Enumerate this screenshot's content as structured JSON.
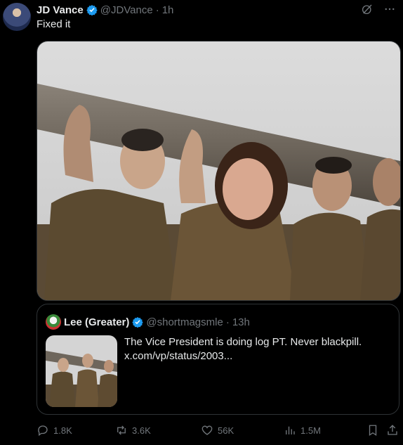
{
  "tweet": {
    "author_name": "JD Vance",
    "author_handle": "@JDVance",
    "separator": "·",
    "time": "1h",
    "text": "Fixed it"
  },
  "quote": {
    "author_name": "Lee (Greater)",
    "author_handle": "@shortmagsmle",
    "separator": "·",
    "time": "13h",
    "text": "The Vice President is doing log PT. Never blackpill. x.com/vp/status/2003..."
  },
  "actions": {
    "replies": "1.8K",
    "reposts": "3.6K",
    "likes": "56K",
    "views": "1.5M"
  },
  "icons": [
    "verified-badge-icon",
    "grok-icon",
    "more-icon",
    "reply-icon",
    "repost-icon",
    "like-icon",
    "views-icon",
    "bookmark-icon",
    "share-icon"
  ],
  "colors": {
    "background": "#000000",
    "text": "#e7e9ea",
    "muted": "#71767b",
    "verified": "#1d9bf0",
    "border": "#2f3336"
  }
}
